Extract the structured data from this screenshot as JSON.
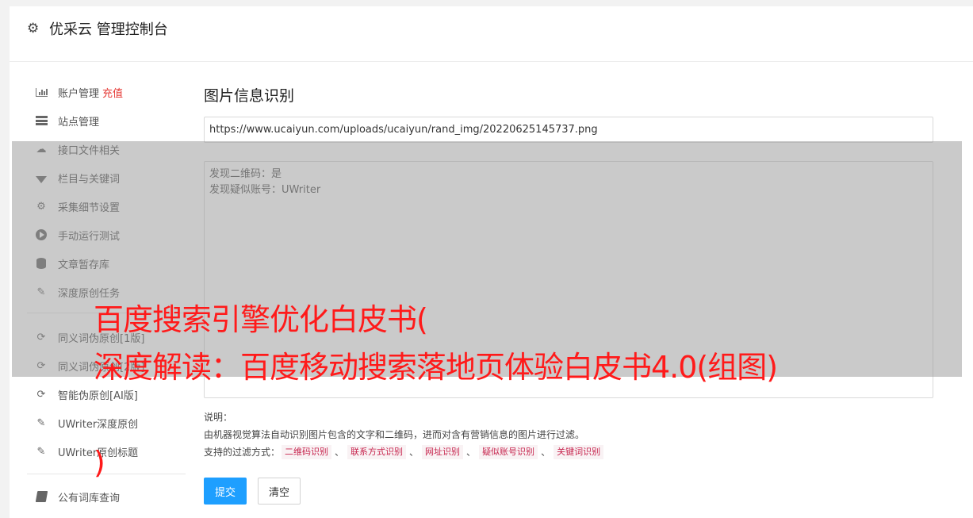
{
  "header": {
    "title": "优采云 管理控制台",
    "icon": "gear-icon"
  },
  "sidebar": {
    "items": [
      {
        "label": "账户管理",
        "extra": "充值",
        "icon": "bar-chart-icon"
      },
      {
        "label": "站点管理",
        "icon": "server-icon"
      },
      {
        "label": "接口文件相关",
        "icon": "cloud-upload-icon"
      },
      {
        "label": "栏目与关键词",
        "icon": "filter-icon"
      },
      {
        "label": "采集细节设置",
        "icon": "cogs-icon"
      },
      {
        "label": "手动运行测试",
        "icon": "play-circle-icon"
      },
      {
        "label": "文章暂存库",
        "icon": "database-icon"
      },
      {
        "label": "深度原创任务",
        "icon": "edit-icon"
      },
      {
        "label": "同义词伪原创[1版]",
        "icon": "refresh-icon"
      },
      {
        "label": "同义词伪原创[2版]",
        "icon": "refresh-icon"
      },
      {
        "label": "智能伪原创[AI版]",
        "icon": "refresh-icon"
      },
      {
        "label": "UWriter深度原创",
        "icon": "edit-icon"
      },
      {
        "label": "UWriter原创标题",
        "icon": "edit-icon"
      },
      {
        "label": "公有词库查询",
        "icon": "book-icon"
      }
    ]
  },
  "main": {
    "heading": "图片信息识别",
    "url_value": "https://www.ucaiyun.com/uploads/ucaiyun/rand_img/20220625145737.png",
    "result_lines": [
      "发现二维码：是",
      "发现疑似账号：UWriter"
    ],
    "desc_title": "说明：",
    "desc_text": "由机器视觉算法自动识别图片包含的文字和二维码，进而对含有营销信息的图片进行过滤。",
    "filter_label": "支持的过滤方式：",
    "filter_tags": [
      "二维码识别",
      "联系方式识别",
      "网址识别",
      "疑似账号识别",
      "关键词识别"
    ],
    "separator": "、",
    "submit_label": "提交",
    "clear_label": "清空"
  },
  "overlay": {
    "line1": "百度搜索引擎优化白皮书(",
    "line2": "深度解读：百度移动搜索落地页体验白皮书4.0(组图)",
    "line3": ")"
  },
  "colors": {
    "accent": "#1e9fff",
    "recharge": "#e53935",
    "overlay_text": "#ff1a1a",
    "tag_text": "#c7254e"
  }
}
